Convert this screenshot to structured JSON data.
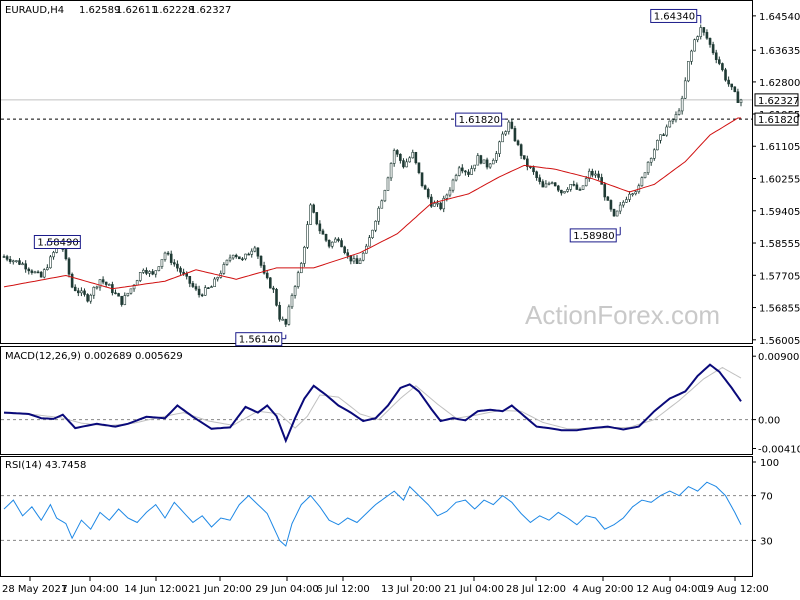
{
  "chart_data": [
    {
      "type": "candlestick",
      "title": "EURAUD,H4",
      "ohlc": {
        "open": "1.62589",
        "high": "1.62611",
        "low": "1.62228",
        "close": "1.62327"
      },
      "ylim": [
        1.56,
        1.648
      ],
      "y_ticks": [
        "1.64540",
        "1.63635",
        "1.62800",
        "1.61955",
        "1.61105",
        "1.60255",
        "1.59405",
        "1.58555",
        "1.57705",
        "1.56855",
        "1.56005"
      ],
      "x_ticks": [
        "28 May 2021",
        "7 Jun 04:00",
        "14 Jun 12:00",
        "21 Jun 20:00",
        "29 Jun 04:00",
        "6 Jul 12:00",
        "13 Jul 20:00",
        "21 Jul 04:00",
        "28 Jul 12:00",
        "4 Aug 20:00",
        "12 Aug 04:00",
        "19 Aug 12:00"
      ],
      "current_price_label": "1.62327",
      "current_price": 1.62327,
      "level_line_label": "1.61820",
      "level_line": 1.6182,
      "annotations": [
        "1.64340",
        "1.61820",
        "1.58490",
        "1.58980",
        "1.56140"
      ],
      "price_path": [
        [
          0,
          1.582
        ],
        [
          6,
          1.58
        ],
        [
          12,
          1.5765
        ],
        [
          17,
          1.5845
        ],
        [
          19,
          1.584
        ],
        [
          22,
          1.574
        ],
        [
          27,
          1.571
        ],
        [
          31,
          1.576
        ],
        [
          34,
          1.574
        ],
        [
          38,
          1.57
        ],
        [
          41,
          1.5735
        ],
        [
          45,
          1.579
        ],
        [
          48,
          1.577
        ],
        [
          52,
          1.583
        ],
        [
          55,
          1.58
        ],
        [
          59,
          1.576
        ],
        [
          63,
          1.572
        ],
        [
          67,
          1.574
        ],
        [
          70,
          1.578
        ],
        [
          74,
          1.583
        ],
        [
          77,
          1.581
        ],
        [
          81,
          1.585
        ],
        [
          84,
          1.577
        ],
        [
          87,
          1.573
        ],
        [
          89,
          1.566
        ],
        [
          91,
          1.564
        ],
        [
          93,
          1.572
        ],
        [
          96,
          1.58
        ],
        [
          99,
          1.595
        ],
        [
          102,
          1.589
        ],
        [
          105,
          1.585
        ],
        [
          108,
          1.587
        ],
        [
          111,
          1.582
        ],
        [
          114,
          1.58
        ],
        [
          117,
          1.584
        ],
        [
          120,
          1.592
        ],
        [
          123,
          1.6
        ],
        [
          126,
          1.61
        ],
        [
          129,
          1.606
        ],
        [
          132,
          1.609
        ],
        [
          135,
          1.601
        ],
        [
          138,
          1.596
        ],
        [
          141,
          1.595
        ],
        [
          144,
          1.6
        ],
        [
          147,
          1.606
        ],
        [
          150,
          1.604
        ],
        [
          153,
          1.608
        ],
        [
          156,
          1.606
        ],
        [
          159,
          1.609
        ],
        [
          161,
          1.614
        ],
        [
          163,
          1.617
        ],
        [
          165,
          1.613
        ],
        [
          168,
          1.607
        ],
        [
          171,
          1.604
        ],
        [
          174,
          1.6
        ],
        [
          177,
          1.602
        ],
        [
          180,
          1.599
        ],
        [
          183,
          1.601
        ],
        [
          186,
          1.599
        ],
        [
          189,
          1.604
        ],
        [
          192,
          1.603
        ],
        [
          195,
          1.596
        ],
        [
          197,
          1.592
        ],
        [
          199,
          1.595
        ],
        [
          202,
          1.599
        ],
        [
          205,
          1.6
        ],
        [
          208,
          1.607
        ],
        [
          211,
          1.612
        ],
        [
          214,
          1.616
        ],
        [
          217,
          1.619
        ],
        [
          219,
          1.623
        ],
        [
          221,
          1.633
        ],
        [
          223,
          1.639
        ],
        [
          225,
          1.642
        ],
        [
          227,
          1.6395
        ],
        [
          229,
          1.636
        ],
        [
          231,
          1.633
        ],
        [
          233,
          1.629
        ],
        [
          235,
          1.626
        ],
        [
          237,
          1.6233
        ]
      ],
      "moving_average_path": [
        [
          0,
          1.574
        ],
        [
          20,
          1.577
        ],
        [
          35,
          1.5735
        ],
        [
          52,
          1.5755
        ],
        [
          62,
          1.5785
        ],
        [
          75,
          1.576
        ],
        [
          88,
          1.579
        ],
        [
          100,
          1.579
        ],
        [
          115,
          1.583
        ],
        [
          127,
          1.588
        ],
        [
          138,
          1.596
        ],
        [
          150,
          1.5985
        ],
        [
          160,
          1.603
        ],
        [
          168,
          1.606
        ],
        [
          178,
          1.605
        ],
        [
          190,
          1.6025
        ],
        [
          202,
          1.599
        ],
        [
          210,
          1.601
        ],
        [
          220,
          1.607
        ],
        [
          228,
          1.614
        ],
        [
          237,
          1.6185
        ]
      ]
    },
    {
      "type": "line",
      "title": "MACD(12,26,9) 0.002689 0.005629",
      "ylim": [
        -0.0046,
        0.0096
      ],
      "y_ticks": [
        "0.009005",
        "0.00",
        "-0.004104"
      ],
      "series": [
        {
          "name": "MACD",
          "color": "#0a0a7a",
          "values": [
            [
              0,
              0.001
            ],
            [
              8,
              0.0008
            ],
            [
              12,
              0.0002
            ],
            [
              16,
              0.0001
            ],
            [
              19,
              0.0007
            ],
            [
              23,
              -0.0012
            ],
            [
              30,
              -0.0006
            ],
            [
              36,
              -0.001
            ],
            [
              40,
              -0.0006
            ],
            [
              46,
              0.0004
            ],
            [
              52,
              0.0002
            ],
            [
              56,
              0.002
            ],
            [
              61,
              0.0004
            ],
            [
              67,
              -0.0013
            ],
            [
              73,
              -0.0011
            ],
            [
              78,
              0.0018
            ],
            [
              82,
              0.001
            ],
            [
              85,
              0.002
            ],
            [
              88,
              0.0005
            ],
            [
              91,
              -0.003
            ],
            [
              94,
              0.0002
            ],
            [
              97,
              0.003
            ],
            [
              100,
              0.0048
            ],
            [
              104,
              0.0035
            ],
            [
              108,
              0.002
            ],
            [
              112,
              0.001
            ],
            [
              116,
              -0.0002
            ],
            [
              120,
              0.0002
            ],
            [
              124,
              0.002
            ],
            [
              128,
              0.0045
            ],
            [
              131,
              0.005
            ],
            [
              134,
              0.004
            ],
            [
              138,
              0.0015
            ],
            [
              141,
              -0.0002
            ],
            [
              145,
              0.0002
            ],
            [
              149,
              -0.0001
            ],
            [
              153,
              0.0012
            ],
            [
              157,
              0.0014
            ],
            [
              161,
              0.0012
            ],
            [
              164,
              0.002
            ],
            [
              168,
              0.0005
            ],
            [
              172,
              -0.001
            ],
            [
              176,
              -0.0012
            ],
            [
              180,
              -0.0015
            ],
            [
              185,
              -0.0015
            ],
            [
              190,
              -0.0012
            ],
            [
              195,
              -0.001
            ],
            [
              200,
              -0.0014
            ],
            [
              205,
              -0.001
            ],
            [
              210,
              0.0012
            ],
            [
              215,
              0.003
            ],
            [
              220,
              0.004
            ],
            [
              224,
              0.0062
            ],
            [
              228,
              0.0078
            ],
            [
              231,
              0.0068
            ],
            [
              235,
              0.0045
            ],
            [
              238,
              0.0026
            ]
          ]
        },
        {
          "name": "Signal",
          "color": "#c0c0c0",
          "values": [
            [
              0,
              0.0009
            ],
            [
              10,
              0.0007
            ],
            [
              18,
              0.0003
            ],
            [
              25,
              -0.0005
            ],
            [
              33,
              -0.0009
            ],
            [
              42,
              -0.0005
            ],
            [
              50,
              0.0003
            ],
            [
              58,
              0.001
            ],
            [
              66,
              -0.0002
            ],
            [
              74,
              -0.0008
            ],
            [
              82,
              0.0012
            ],
            [
              89,
              0.0008
            ],
            [
              94,
              -0.0012
            ],
            [
              98,
              0.0005
            ],
            [
              102,
              0.0035
            ],
            [
              108,
              0.0032
            ],
            [
              115,
              0.0008
            ],
            [
              121,
              0.0
            ],
            [
              128,
              0.003
            ],
            [
              133,
              0.0048
            ],
            [
              140,
              0.0022
            ],
            [
              146,
              0.0002
            ],
            [
              152,
              0.0006
            ],
            [
              160,
              0.0013
            ],
            [
              167,
              0.0012
            ],
            [
              174,
              -0.0004
            ],
            [
              182,
              -0.0013
            ],
            [
              192,
              -0.0012
            ],
            [
              202,
              -0.0011
            ],
            [
              210,
              0.0
            ],
            [
              218,
              0.0027
            ],
            [
              226,
              0.0058
            ],
            [
              232,
              0.0074
            ],
            [
              238,
              0.0059
            ]
          ]
        }
      ]
    },
    {
      "type": "line",
      "title": "RSI(14) 43.7458",
      "ylim": [
        0,
        100
      ],
      "y_ticks": [
        "100",
        "70",
        "30"
      ],
      "levels": [
        70,
        30
      ],
      "series": [
        {
          "name": "RSI",
          "color": "#1e88e5",
          "values": [
            [
              0,
              58
            ],
            [
              3,
              66
            ],
            [
              6,
              52
            ],
            [
              9,
              60
            ],
            [
              12,
              48
            ],
            [
              15,
              62
            ],
            [
              17,
              50
            ],
            [
              20,
              45
            ],
            [
              22,
              32
            ],
            [
              25,
              48
            ],
            [
              28,
              40
            ],
            [
              31,
              55
            ],
            [
              34,
              48
            ],
            [
              37,
              58
            ],
            [
              40,
              50
            ],
            [
              43,
              46
            ],
            [
              46,
              55
            ],
            [
              49,
              62
            ],
            [
              52,
              50
            ],
            [
              55,
              64
            ],
            [
              58,
              55
            ],
            [
              61,
              46
            ],
            [
              64,
              52
            ],
            [
              67,
              42
            ],
            [
              70,
              50
            ],
            [
              73,
              48
            ],
            [
              76,
              62
            ],
            [
              79,
              70
            ],
            [
              82,
              62
            ],
            [
              85,
              54
            ],
            [
              87,
              42
            ],
            [
              89,
              30
            ],
            [
              91,
              25
            ],
            [
              93,
              45
            ],
            [
              96,
              62
            ],
            [
              99,
              70
            ],
            [
              102,
              60
            ],
            [
              105,
              48
            ],
            [
              108,
              44
            ],
            [
              111,
              50
            ],
            [
              114,
              46
            ],
            [
              117,
              54
            ],
            [
              120,
              62
            ],
            [
              123,
              68
            ],
            [
              126,
              74
            ],
            [
              129,
              66
            ],
            [
              131,
              78
            ],
            [
              134,
              70
            ],
            [
              137,
              62
            ],
            [
              140,
              52
            ],
            [
              143,
              56
            ],
            [
              146,
              64
            ],
            [
              149,
              66
            ],
            [
              152,
              58
            ],
            [
              155,
              66
            ],
            [
              158,
              62
            ],
            [
              161,
              70
            ],
            [
              164,
              64
            ],
            [
              167,
              54
            ],
            [
              170,
              46
            ],
            [
              173,
              52
            ],
            [
              176,
              48
            ],
            [
              179,
              55
            ],
            [
              182,
              50
            ],
            [
              185,
              44
            ],
            [
              188,
              52
            ],
            [
              191,
              50
            ],
            [
              194,
              40
            ],
            [
              197,
              44
            ],
            [
              200,
              50
            ],
            [
              203,
              60
            ],
            [
              206,
              66
            ],
            [
              209,
              64
            ],
            [
              212,
              70
            ],
            [
              215,
              74
            ],
            [
              218,
              70
            ],
            [
              221,
              78
            ],
            [
              224,
              74
            ],
            [
              227,
              82
            ],
            [
              230,
              78
            ],
            [
              233,
              70
            ],
            [
              236,
              55
            ],
            [
              238,
              44
            ]
          ]
        }
      ]
    }
  ],
  "watermark": "ActionForex.com"
}
